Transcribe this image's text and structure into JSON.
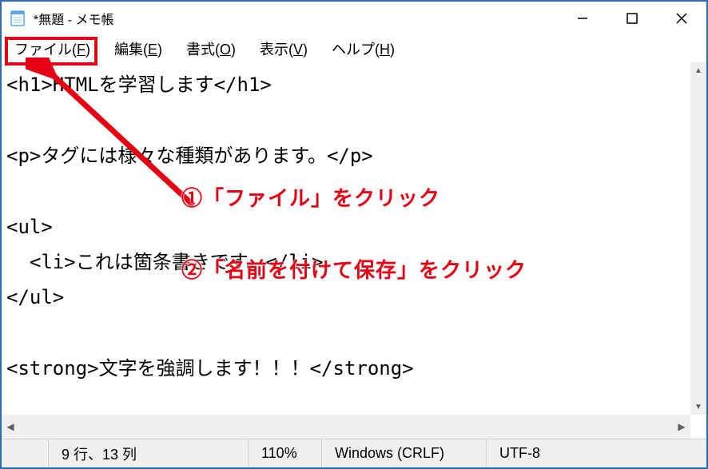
{
  "titlebar": {
    "title": "*無題 - メモ帳"
  },
  "menubar": {
    "file": {
      "label": "ファイル(",
      "accel": "F",
      "tail": ")"
    },
    "edit": {
      "label": "編集(",
      "accel": "E",
      "tail": ")"
    },
    "format": {
      "label": "書式(",
      "accel": "O",
      "tail": ")"
    },
    "view": {
      "label": "表示(",
      "accel": "V",
      "tail": ")"
    },
    "help": {
      "label": "ヘルプ(",
      "accel": "H",
      "tail": ")"
    }
  },
  "editor": {
    "content": "<h1>HTMLを学習します</h1>\n\n<p>タグには様々な種類があります。</p>\n\n<ul>\n  <li>これは箇条書きです。</li>\n</ul>\n\n<strong>文字を強調します！！！</strong>"
  },
  "annotations": {
    "step1": "①「ファイル」をクリック",
    "step2": "②「名前を付けて保存」をクリック"
  },
  "statusbar": {
    "position": "9 行、13 列",
    "zoom": "110%",
    "line_ending": "Windows (CRLF)",
    "encoding": "UTF-8"
  },
  "colors": {
    "accent_red": "#e60012",
    "border_blue": "#2b6cb0"
  }
}
